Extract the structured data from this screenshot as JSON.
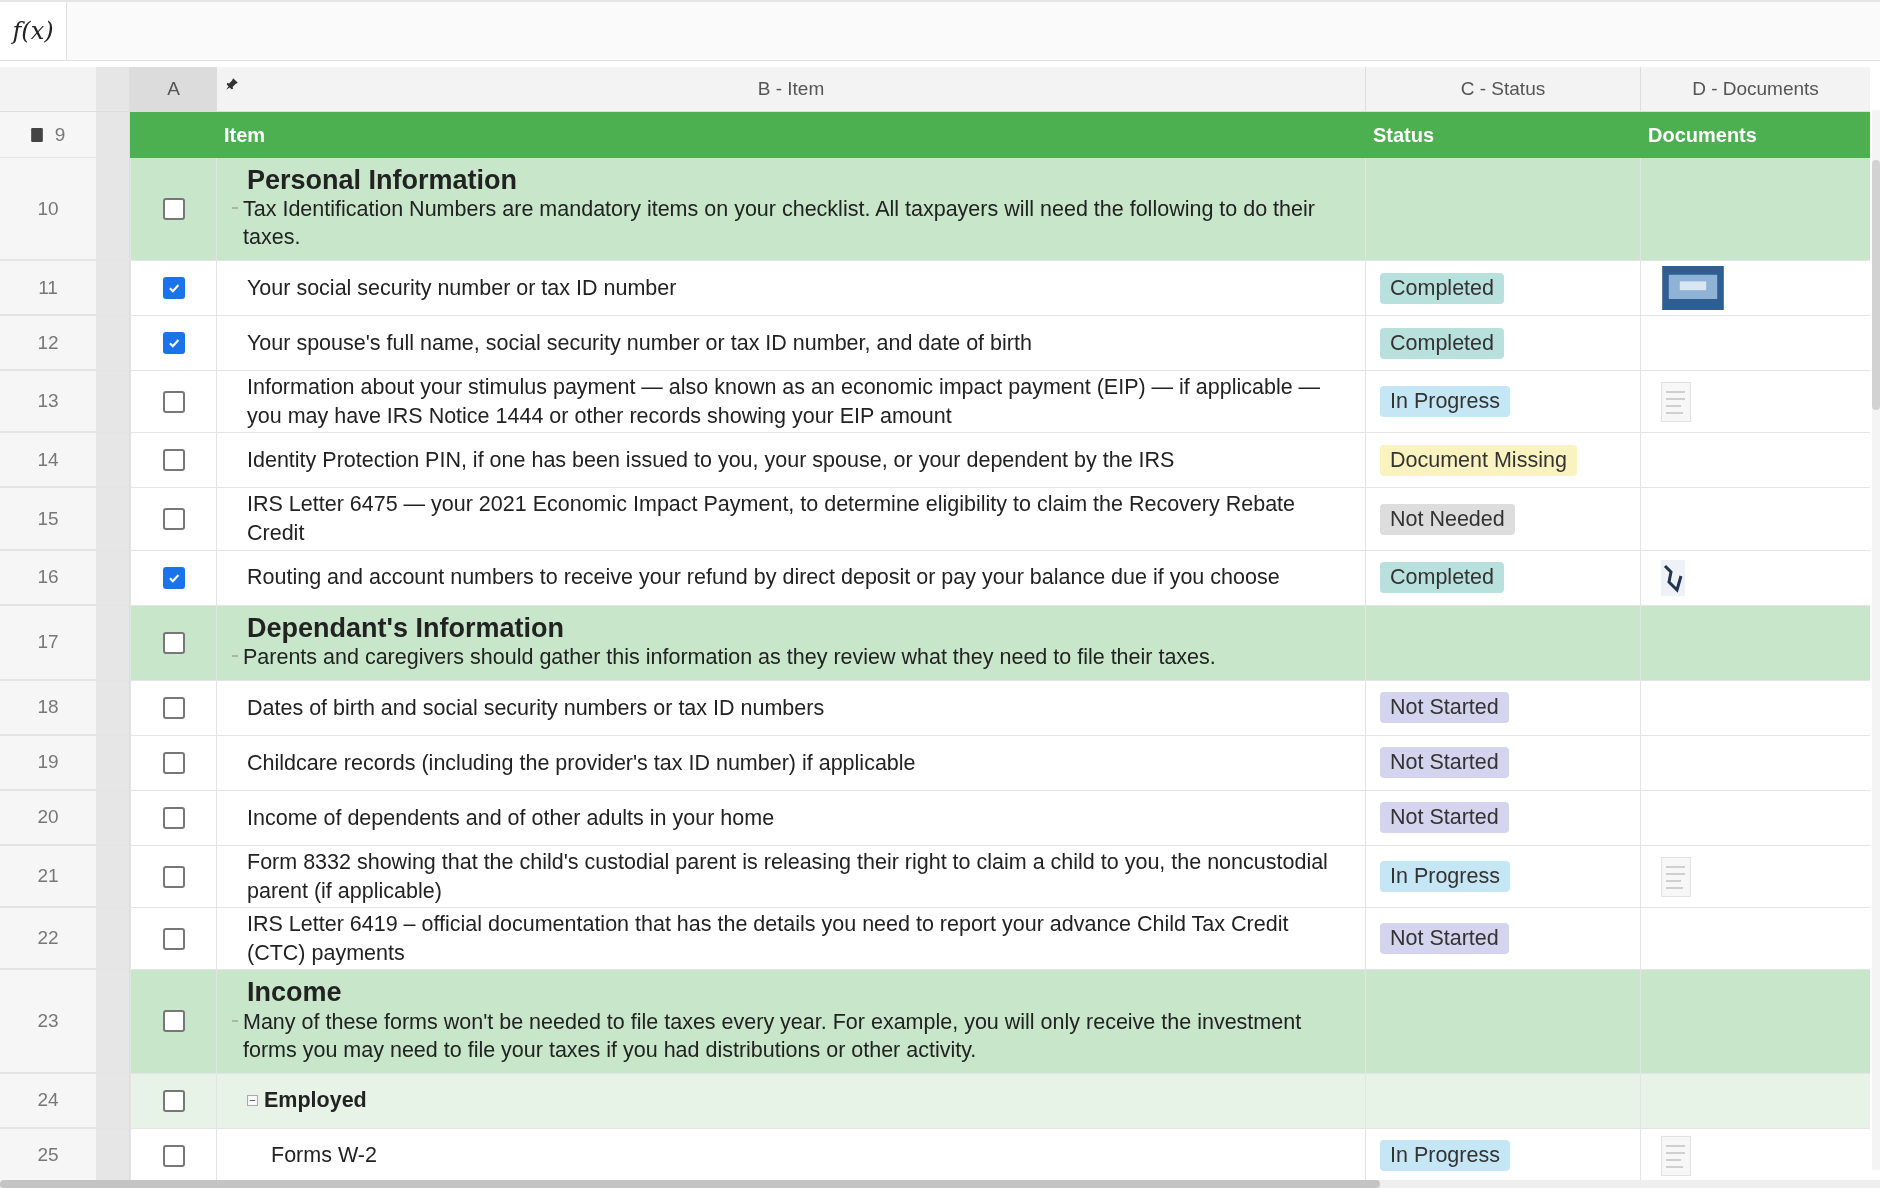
{
  "formula_bar": {
    "label": "f(x)"
  },
  "columns": [
    {
      "label": "A",
      "selected": true
    },
    {
      "label": "B - Item",
      "selected": false
    },
    {
      "label": "C - Status",
      "selected": false
    },
    {
      "label": "D - Documents",
      "selected": false
    }
  ],
  "header_row": {
    "row": "9",
    "cells": [
      "Item",
      "Status",
      "Documents"
    ]
  },
  "sections": [
    {
      "kind": "section",
      "row": "10",
      "checked": false,
      "expanded": true,
      "title": "Personal Information",
      "description": "Tax Identification Numbers are mandatory items on your checklist. All taxpayers will need the following to do their taxes.",
      "children": [
        {
          "kind": "item",
          "row": "11",
          "checked": true,
          "text": "Your social security number or tax ID number",
          "status": {
            "label": "Completed",
            "color": "#b8e0dc"
          },
          "documents": [
            {
              "kind": "screen"
            }
          ]
        },
        {
          "kind": "item",
          "row": "12",
          "checked": true,
          "text": "Your spouse's full name, social security number or tax ID number, and date of birth",
          "status": {
            "label": "Completed",
            "color": "#b8e0dc"
          }
        },
        {
          "kind": "item",
          "row": "13",
          "checked": false,
          "text": "Information about your stimulus payment — also known as an economic impact payment (EIP) — if applicable — you may have IRS Notice 1444 or other records showing your EIP amount",
          "status": {
            "label": "In Progress",
            "color": "#c4e6f5"
          },
          "documents": [
            {
              "kind": "page"
            }
          ]
        },
        {
          "kind": "item",
          "row": "14",
          "checked": false,
          "text": "Identity Protection PIN, if one has been issued to you, your spouse, or your dependent by the IRS",
          "status": {
            "label": "Document Missing",
            "color": "#faf3c0"
          }
        },
        {
          "kind": "item",
          "row": "15",
          "checked": false,
          "text": "IRS Letter 6475 — your 2021 Economic Impact Payment, to determine eligibility to claim the Recovery Rebate Credit",
          "status": {
            "label": "Not Needed",
            "color": "#dddddd"
          }
        },
        {
          "kind": "item",
          "row": "16",
          "checked": true,
          "text": "Routing and account numbers to receive your refund by direct deposit or pay your balance due if you choose",
          "status": {
            "label": "Completed",
            "color": "#b8e0dc"
          },
          "documents": [
            {
              "kind": "note"
            }
          ]
        }
      ]
    },
    {
      "kind": "section",
      "row": "17",
      "checked": false,
      "expanded": true,
      "title": "Dependant's Information",
      "description": "Parents and caregivers should gather this information as they review what they need to file their taxes.",
      "children": [
        {
          "kind": "item",
          "row": "18",
          "checked": false,
          "text": "Dates of birth and social security numbers or tax ID numbers",
          "status": {
            "label": "Not Started",
            "color": "#d4d4ee"
          }
        },
        {
          "kind": "item",
          "row": "19",
          "checked": false,
          "text": "Childcare records (including the provider's tax ID number) if applicable",
          "status": {
            "label": "Not Started",
            "color": "#d4d4ee"
          }
        },
        {
          "kind": "item",
          "row": "20",
          "checked": false,
          "text": "Income of dependents and of other adults in your home",
          "status": {
            "label": "Not Started",
            "color": "#d4d4ee"
          }
        },
        {
          "kind": "item",
          "row": "21",
          "checked": false,
          "text": "Form 8332 showing that the child's custodial parent is releasing their right to claim a child to you, the noncustodial parent (if applicable)",
          "status": {
            "label": "In Progress",
            "color": "#c4e6f5"
          },
          "documents": [
            {
              "kind": "page"
            }
          ]
        },
        {
          "kind": "item",
          "row": "22",
          "checked": false,
          "text": "IRS Letter 6419 – official documentation that has the details you need to report your advance Child Tax Credit (CTC) payments",
          "status": {
            "label": "Not Started",
            "color": "#d4d4ee"
          }
        }
      ]
    },
    {
      "kind": "section",
      "row": "23",
      "checked": false,
      "expanded": true,
      "title": "Income",
      "description": "Many of these forms won't be needed to file taxes every year. For example, you will only receive the investment forms you may need to file your taxes if you had distributions or other activity.",
      "children": [
        {
          "kind": "group",
          "row": "24",
          "checked": false,
          "expanded": true,
          "text": "Employed",
          "children": [
            {
              "kind": "item",
              "row": "25",
              "checked": false,
              "text": "Forms W-2",
              "status": {
                "label": "In Progress",
                "color": "#c4e6f5"
              },
              "documents": [
                {
                  "kind": "page"
                }
              ]
            }
          ]
        }
      ]
    }
  ]
}
